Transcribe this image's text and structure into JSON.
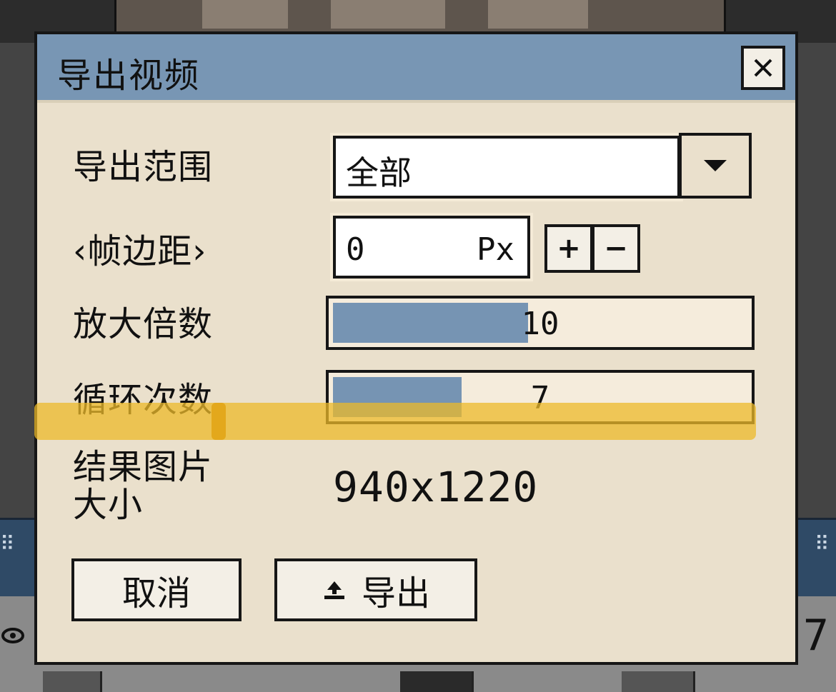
{
  "dialog": {
    "title": "导出视频",
    "close_icon": "close-icon"
  },
  "form": {
    "export_range": {
      "label": "导出范围",
      "value": "全部",
      "dropdown_icon": "triangle-down-icon"
    },
    "frame_margin": {
      "label": "‹帧边距›",
      "value": "0",
      "unit": "Px",
      "increment_label": "+",
      "decrement_label": "−"
    },
    "scale": {
      "label": "放大倍数",
      "value": "10",
      "fill_fraction": 0.47
    },
    "loop_count": {
      "label": "循环次数",
      "value": "7",
      "fill_fraction": 0.31
    },
    "result_size": {
      "label_line1": "结果图片",
      "label_line2": "大小",
      "value": "940x1220"
    }
  },
  "buttons": {
    "cancel_label": "取消",
    "export_label": "导出",
    "export_icon": "upload-icon"
  },
  "background": {
    "corner_number": "7"
  },
  "colors": {
    "title_bar": "#7896b4",
    "dialog_bg": "#eae0cc",
    "slider_fill": "#7694b3",
    "highlight": "#ecba2a"
  }
}
